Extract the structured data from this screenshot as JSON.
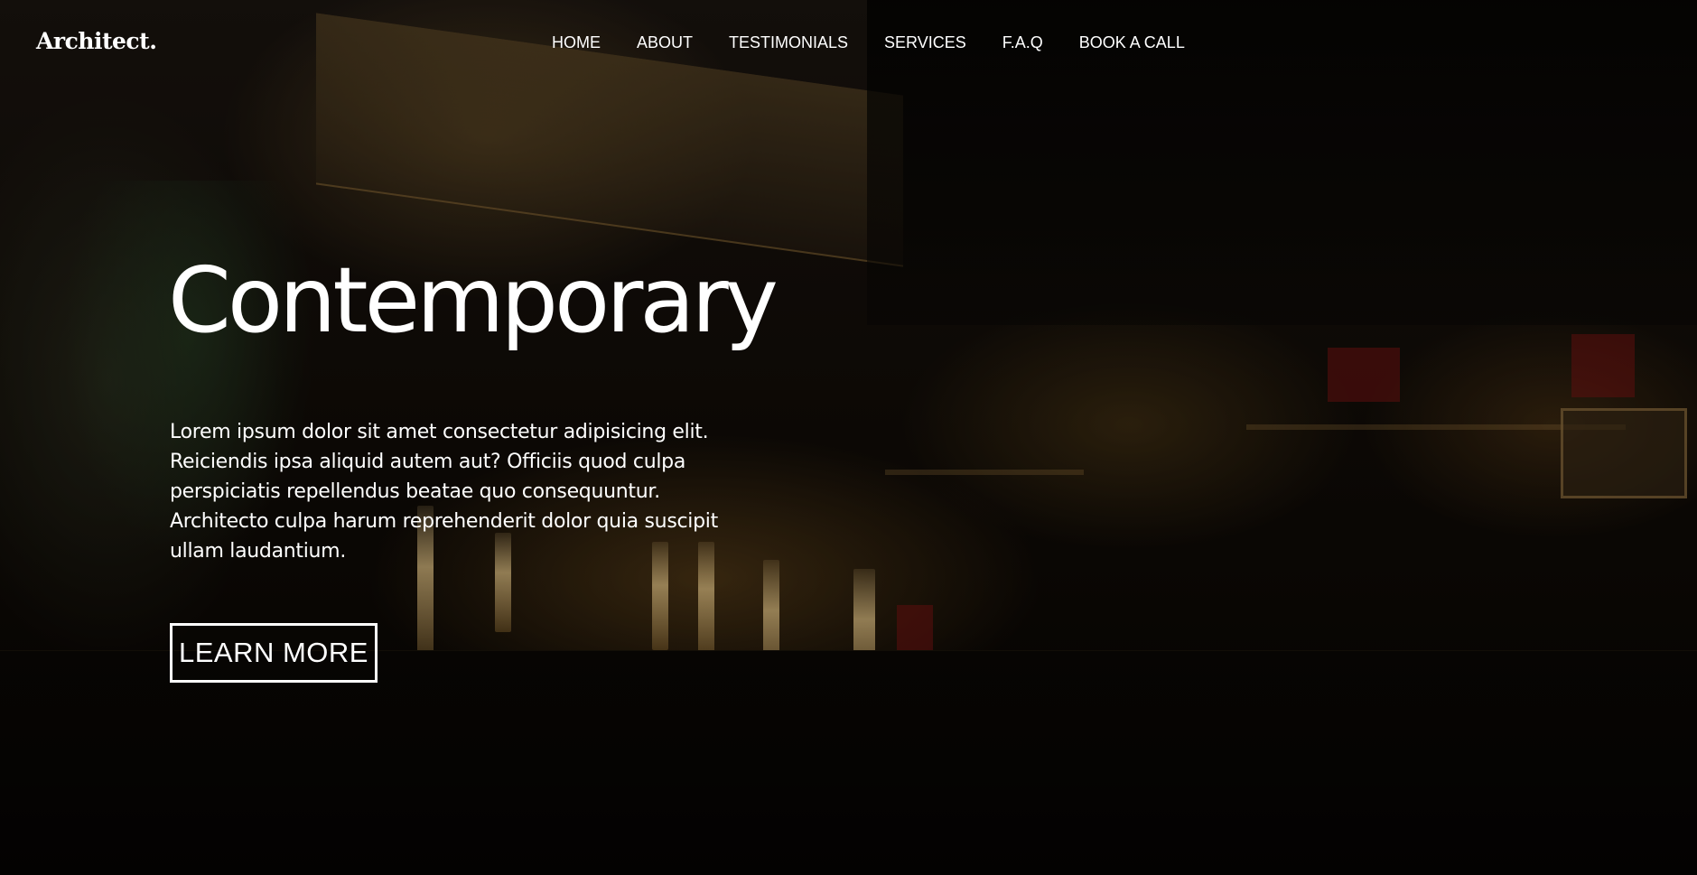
{
  "brand": {
    "logo_text": "Architect."
  },
  "nav": {
    "items": [
      {
        "label": "HOME"
      },
      {
        "label": "ABOUT"
      },
      {
        "label": "TESTIMONIALS"
      },
      {
        "label": "SERVICES"
      },
      {
        "label": "F.A.Q"
      },
      {
        "label": "BOOK A CALL"
      }
    ]
  },
  "hero": {
    "title": "Contemporary",
    "body": "Lorem ipsum dolor sit amet consectetur adipisicing elit. Reiciendis ipsa aliquid autem aut? Officiis quod culpa perspiciatis repellendus beatae quo consequuntur. Architecto culpa harum reprehenderit dolor quia suscipit ullam laudantium.",
    "cta_label": "LEARN MORE",
    "background_image": "dark bar interior with liquor shelves",
    "overlay_color": "#000000"
  },
  "colors": {
    "text": "#ffffff",
    "button_border": "#ffffff"
  }
}
